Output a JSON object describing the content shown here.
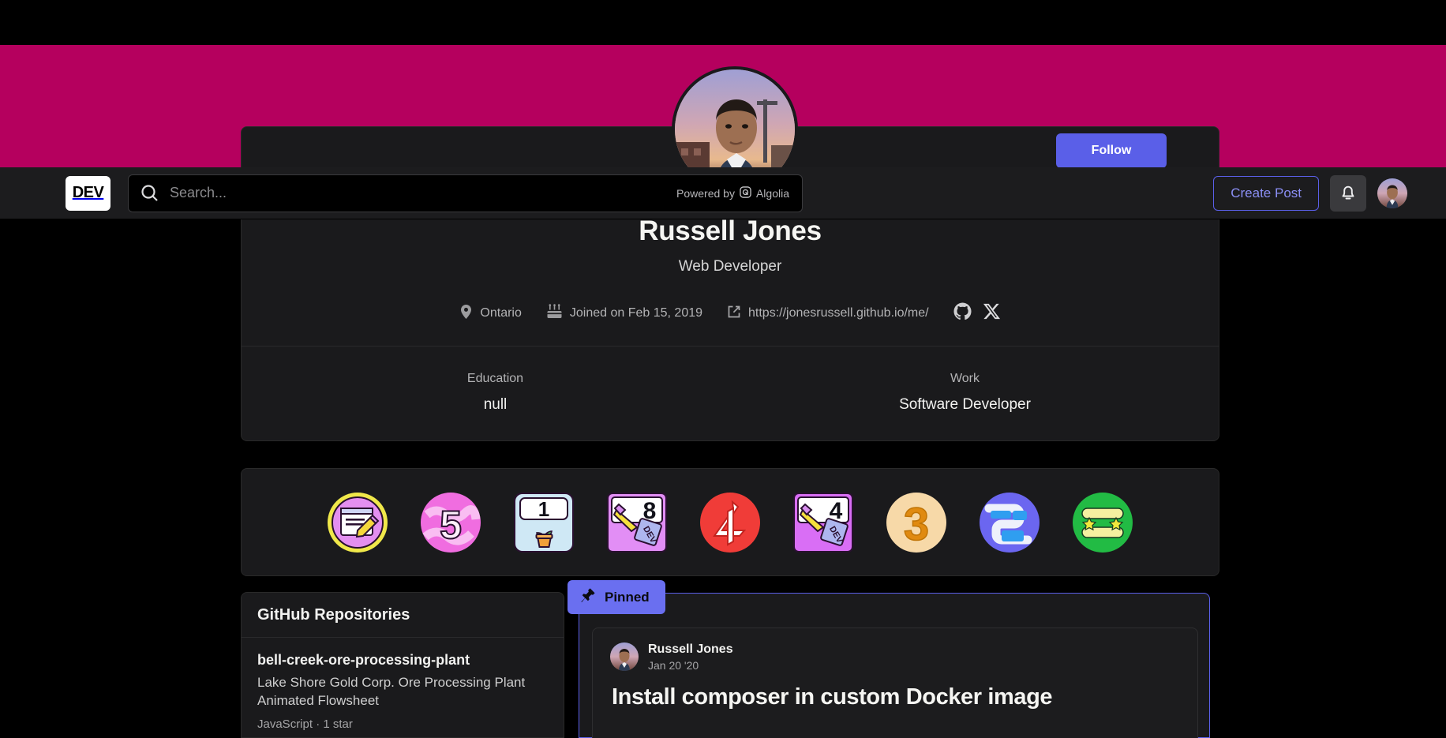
{
  "navbar": {
    "logo_text": "DEV",
    "search_placeholder": "Search...",
    "search_value": "",
    "algolia_text": "Powered by",
    "algolia_brand": "Algolia",
    "create_post_label": "Create Post"
  },
  "profile": {
    "name": "Russell Jones",
    "tagline": "Web Developer",
    "follow_label": "Follow",
    "location": "Ontario",
    "joined": "Joined on Feb 15, 2019",
    "website": "https://jonesrussell.github.io/me/",
    "details": [
      {
        "label": "Education",
        "value": "null"
      },
      {
        "label": "Work",
        "value": "Software Developer"
      }
    ]
  },
  "badges": [
    {
      "name": "writing-debut-badge",
      "number": "",
      "colors": {
        "bg": "#e48ff0",
        "ring": "#f5e642"
      }
    },
    {
      "name": "five-week-writing-streak-badge",
      "number": "5",
      "colors": {
        "bg": "#f06de0",
        "ring": "#f7b8ee"
      }
    },
    {
      "name": "one-year-club-badge",
      "number": "1",
      "colors": {
        "bg": "#cfe8f5",
        "ring": "#ffffff"
      }
    },
    {
      "name": "eight-week-writing-streak-badge",
      "number": "8",
      "colors": {
        "bg": "#e28ef5",
        "ring": "#f0b6fa"
      }
    },
    {
      "name": "four-year-club-badge",
      "number": "4",
      "colors": {
        "bg": "#f03c38",
        "ring": "#ffffff"
      }
    },
    {
      "name": "four-week-writing-streak-badge",
      "number": "4",
      "colors": {
        "bg": "#d96ef5",
        "ring": "#eab6fa"
      }
    },
    {
      "name": "three-year-club-badge",
      "number": "3",
      "colors": {
        "bg": "#f5d5a0",
        "ring": "#e08a10"
      }
    },
    {
      "name": "two-year-club-badge",
      "number": "2",
      "colors": {
        "bg": "#6b66f0",
        "ring": "#2f9ef0"
      }
    },
    {
      "name": "hacktoberfest-badge",
      "number": "",
      "colors": {
        "bg": "#22bb44",
        "ring": "#f5f0a0"
      }
    }
  ],
  "github_panel": {
    "heading": "GitHub Repositories",
    "repos": [
      {
        "name": "bell-creek-ore-processing-plant",
        "description": "Lake Shore Gold Corp. Ore Processing Plant Animated Flowsheet",
        "meta": "JavaScript · 1 star"
      }
    ]
  },
  "pinned": {
    "flag_label": "Pinned",
    "post": {
      "author": "Russell Jones",
      "date": "Jan 20 '20",
      "title": "Install composer in custom Docker image"
    }
  },
  "colors": {
    "banner": "#b5005e",
    "accent_indigo": "#5a5fe8",
    "card_bg": "#1a1a1c",
    "page_bg": "#000000"
  }
}
